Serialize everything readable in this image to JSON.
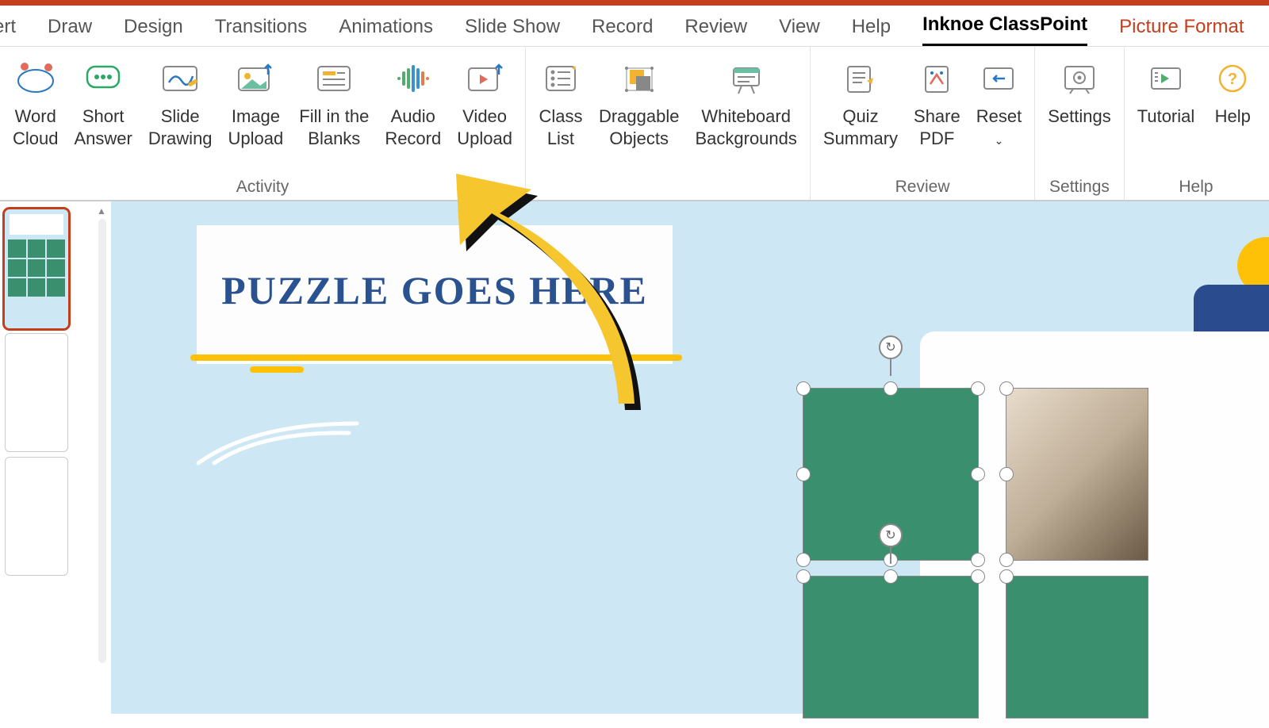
{
  "tabs": {
    "insert": "ert",
    "draw": "Draw",
    "design": "Design",
    "transitions": "Transitions",
    "animations": "Animations",
    "slideshow": "Slide Show",
    "record": "Record",
    "review": "Review",
    "view": "View",
    "help": "Help",
    "classpoint": "Inknoe ClassPoint",
    "picture_format": "Picture Format"
  },
  "ribbon": {
    "activity_group": "Activity",
    "review_group": "Review",
    "settings_group": "Settings",
    "help_group": "Help",
    "word_cloud": "Word\nCloud",
    "short_answer": "Short\nAnswer",
    "slide_drawing": "Slide\nDrawing",
    "image_upload": "Image\nUpload",
    "fill_blanks": "Fill in the\nBlanks",
    "audio_record": "Audio\nRecord",
    "video_upload": "Video\nUpload",
    "class_list": "Class\nList",
    "draggable_objects": "Draggable\nObjects",
    "whiteboard_bg": "Whiteboard\nBackgrounds",
    "quiz_summary": "Quiz\nSummary",
    "share_pdf": "Share\nPDF",
    "reset": "Reset",
    "settings": "Settings",
    "tutorial": "Tutorial",
    "help_btn": "Help"
  },
  "slide": {
    "title": "PUZZLE GOES\nHERE"
  }
}
